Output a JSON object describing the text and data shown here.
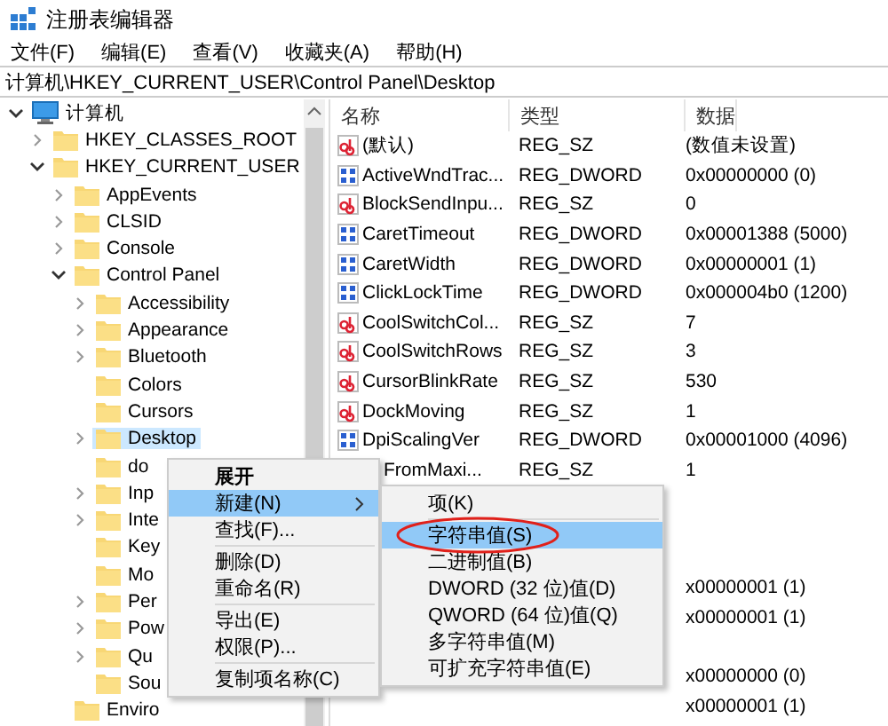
{
  "window": {
    "title": "注册表编辑器"
  },
  "menu_bar": [
    "文件(F)",
    "编辑(E)",
    "查看(V)",
    "收藏夹(A)",
    "帮助(H)"
  ],
  "address": "计算机\\HKEY_CURRENT_USER\\Control Panel\\Desktop",
  "tree": [
    {
      "label": "计算机",
      "kind": "computer",
      "expandable": true,
      "expanded": true,
      "selected": false,
      "children": [
        {
          "label": "HKEY_CLASSES_ROOT",
          "kind": "folder",
          "expandable": true,
          "expanded": false,
          "selected": false
        },
        {
          "label": "HKEY_CURRENT_USER",
          "kind": "folder",
          "expandable": true,
          "expanded": true,
          "selected": false,
          "children": [
            {
              "label": "AppEvents",
              "kind": "folder",
              "expandable": true,
              "expanded": false,
              "selected": false
            },
            {
              "label": "CLSID",
              "kind": "folder",
              "expandable": true,
              "expanded": false,
              "selected": false
            },
            {
              "label": "Console",
              "kind": "folder",
              "expandable": true,
              "expanded": false,
              "selected": false
            },
            {
              "label": "Control Panel",
              "kind": "folder",
              "expandable": true,
              "expanded": true,
              "selected": false,
              "children": [
                {
                  "label": "Accessibility",
                  "kind": "folder",
                  "expandable": true,
                  "expanded": false,
                  "selected": false
                },
                {
                  "label": "Appearance",
                  "kind": "folder",
                  "expandable": true,
                  "expanded": false,
                  "selected": false
                },
                {
                  "label": "Bluetooth",
                  "kind": "folder",
                  "expandable": true,
                  "expanded": false,
                  "selected": false
                },
                {
                  "label": "Colors",
                  "kind": "folder",
                  "expandable": false,
                  "selected": false
                },
                {
                  "label": "Cursors",
                  "kind": "folder",
                  "expandable": false,
                  "selected": false
                },
                {
                  "label": "Desktop",
                  "kind": "folder",
                  "expandable": true,
                  "expanded": false,
                  "selected": true
                },
                {
                  "label": "do",
                  "kind": "folder",
                  "expandable": false,
                  "selected": false
                },
                {
                  "label": "Inp",
                  "kind": "folder",
                  "expandable": true,
                  "expanded": false,
                  "selected": false
                },
                {
                  "label": "Inte",
                  "kind": "folder",
                  "expandable": true,
                  "expanded": false,
                  "selected": false
                },
                {
                  "label": "Key",
                  "kind": "folder",
                  "expandable": false,
                  "selected": false
                },
                {
                  "label": "Mo",
                  "kind": "folder",
                  "expandable": false,
                  "selected": false
                },
                {
                  "label": "Per",
                  "kind": "folder",
                  "expandable": true,
                  "expanded": false,
                  "selected": false
                },
                {
                  "label": "Pow",
                  "kind": "folder",
                  "expandable": true,
                  "expanded": false,
                  "selected": false
                },
                {
                  "label": "Qu",
                  "kind": "folder",
                  "expandable": true,
                  "expanded": false,
                  "selected": false
                },
                {
                  "label": "Sou",
                  "kind": "folder",
                  "expandable": false,
                  "selected": false
                }
              ]
            },
            {
              "label": "Enviro",
              "kind": "folder",
              "expandable": false,
              "selected": false
            }
          ]
        }
      ]
    }
  ],
  "table": {
    "columns": [
      "名称",
      "类型",
      "数据"
    ],
    "rows": [
      {
        "kind": "string",
        "name": "(默认)",
        "type": "REG_SZ",
        "data": "(数值未设置)"
      },
      {
        "kind": "number",
        "name": "ActiveWndTrac...",
        "type": "REG_DWORD",
        "data": "0x00000000 (0)"
      },
      {
        "kind": "string",
        "name": "BlockSendInpu...",
        "type": "REG_SZ",
        "data": "0"
      },
      {
        "kind": "number",
        "name": "CaretTimeout",
        "type": "REG_DWORD",
        "data": "0x00001388 (5000)"
      },
      {
        "kind": "number",
        "name": "CaretWidth",
        "type": "REG_DWORD",
        "data": "0x00000001 (1)"
      },
      {
        "kind": "number",
        "name": "ClickLockTime",
        "type": "REG_DWORD",
        "data": "0x000004b0 (1200)"
      },
      {
        "kind": "string",
        "name": "CoolSwitchCol...",
        "type": "REG_SZ",
        "data": "7"
      },
      {
        "kind": "string",
        "name": "CoolSwitchRows",
        "type": "REG_SZ",
        "data": "3"
      },
      {
        "kind": "string",
        "name": "CursorBlinkRate",
        "type": "REG_SZ",
        "data": "530"
      },
      {
        "kind": "string",
        "name": "DockMoving",
        "type": "REG_SZ",
        "data": "1"
      },
      {
        "kind": "number",
        "name": "DpiScalingVer",
        "type": "REG_DWORD",
        "data": "0x00001000 (4096)"
      },
      {
        "kind": "covered",
        "name": "FromMaxi...",
        "type": "REG_SZ",
        "data": "1"
      },
      {
        "kind": "covered"
      },
      {
        "kind": "covered"
      },
      {
        "kind": "covered"
      },
      {
        "kind": "covered",
        "data": "x00000001 (1)"
      },
      {
        "kind": "covered",
        "data": "x00000001 (1)"
      },
      {
        "kind": "covered"
      },
      {
        "kind": "covered",
        "data": "x00000000 (0)"
      },
      {
        "kind": "covered",
        "data": "x00000001 (1)"
      }
    ]
  },
  "context_menu": [
    {
      "kind": "item",
      "label": "展开",
      "default": true,
      "selected": false,
      "has_submenu": false
    },
    {
      "kind": "item",
      "label": "新建(N)",
      "default": false,
      "selected": true,
      "has_submenu": true
    },
    {
      "kind": "item",
      "label": "查找(F)...",
      "default": false,
      "selected": false,
      "has_submenu": false
    },
    {
      "kind": "separator"
    },
    {
      "kind": "item",
      "label": "删除(D)",
      "default": false,
      "selected": false,
      "has_submenu": false
    },
    {
      "kind": "item",
      "label": "重命名(R)",
      "default": false,
      "selected": false,
      "has_submenu": false
    },
    {
      "kind": "separator"
    },
    {
      "kind": "item",
      "label": "导出(E)",
      "default": false,
      "selected": false,
      "has_submenu": false
    },
    {
      "kind": "item",
      "label": "权限(P)...",
      "default": false,
      "selected": false,
      "has_submenu": false
    },
    {
      "kind": "separator"
    },
    {
      "kind": "item",
      "label": "复制项名称(C)",
      "default": false,
      "selected": false,
      "has_submenu": false
    }
  ],
  "submenu": [
    {
      "kind": "item",
      "label": "项(K)",
      "selected": false,
      "circled": false
    },
    {
      "kind": "separator"
    },
    {
      "kind": "item",
      "label": "字符串值(S)",
      "selected": true,
      "circled": true
    },
    {
      "kind": "item",
      "label": "二进制值(B)",
      "selected": false,
      "circled": false
    },
    {
      "kind": "item",
      "label": "DWORD (32 位)值(D)",
      "selected": false,
      "circled": false
    },
    {
      "kind": "item",
      "label": "QWORD (64 位)值(Q)",
      "selected": false,
      "circled": false
    },
    {
      "kind": "item",
      "label": "多字符串值(M)",
      "selected": false,
      "circled": false
    },
    {
      "kind": "item",
      "label": "可扩充字符串值(E)",
      "selected": false,
      "circled": false
    }
  ]
}
